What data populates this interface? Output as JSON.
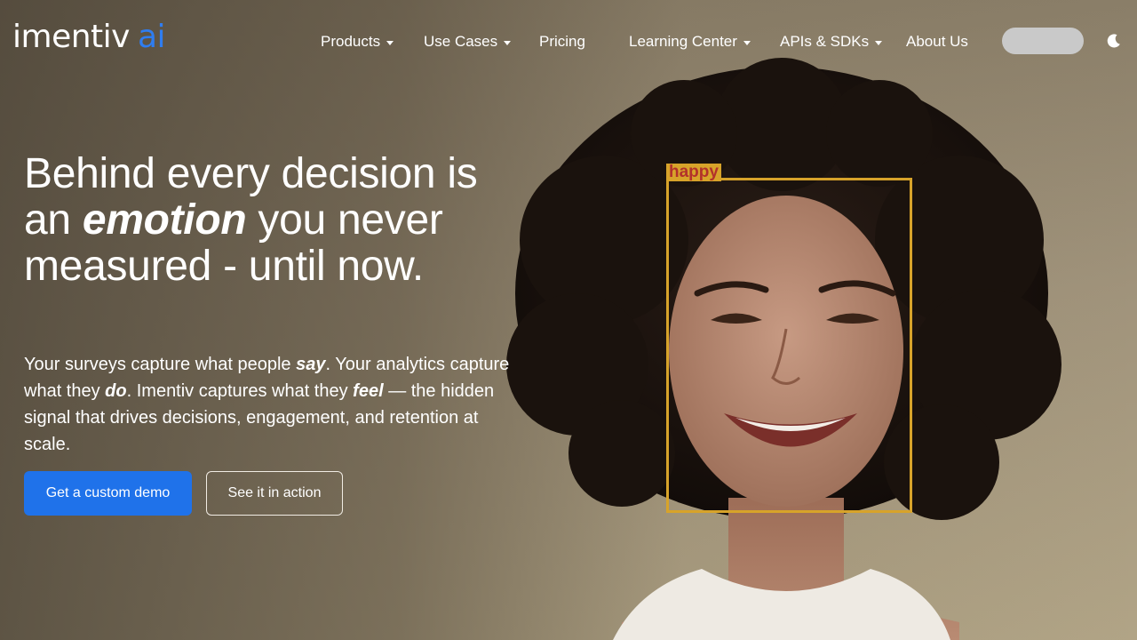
{
  "logo": {
    "main": "imentiv",
    "accent": "ai"
  },
  "nav": {
    "items": [
      {
        "label": "Products",
        "has_dropdown": true
      },
      {
        "label": "Use Cases",
        "has_dropdown": true
      },
      {
        "label": "Pricing",
        "has_dropdown": false
      },
      {
        "label": "Learning Center",
        "has_dropdown": true
      },
      {
        "label": "APIs & SDKs",
        "has_dropdown": true
      },
      {
        "label": "About Us",
        "has_dropdown": false
      }
    ],
    "theme_icon": "moon-icon"
  },
  "hero": {
    "title_part1": "Behind every decision is an ",
    "title_em": "emotion",
    "title_part2": " you never measured - until now.",
    "sub": {
      "p1": "Your surveys capture what people ",
      "e1": "say",
      "p2": ". Your analytics capture what they ",
      "e2": "do",
      "p3": ". Imentiv captures what they ",
      "e3": "feel",
      "p4": " — the hidden signal that drives decisions, engagement, and retention at scale."
    },
    "primary_cta": "Get a custom demo",
    "secondary_cta": "See it in action"
  },
  "detection": {
    "label": "happy"
  },
  "colors": {
    "accent_blue": "#1f72ea",
    "logo_ai": "#2f7df0",
    "detect_box": "#d7a32a",
    "detect_text": "#b2312b"
  }
}
